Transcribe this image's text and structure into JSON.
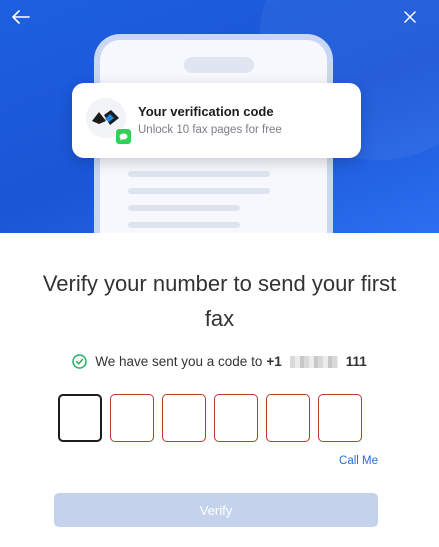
{
  "header": {
    "back_icon": "arrow-left-icon",
    "close_icon": "close-icon"
  },
  "notification": {
    "title": "Your verification code",
    "subtitle": "Unlock 10 fax pages for free",
    "app_icon": "fax-logo-icon",
    "badge_icon": "message-icon"
  },
  "main": {
    "heading_line1": "Verify your number to send your first",
    "heading_line2": "fax",
    "sent_text": "We have sent you a code to",
    "phone_prefix": "+1",
    "phone_suffix": "111",
    "call_me": "Call Me",
    "verify_label": "Verify"
  },
  "otp": {
    "digits": 6,
    "values": [
      "",
      "",
      "",
      "",
      "",
      ""
    ]
  },
  "colors": {
    "hero": "#1a56d6",
    "accent_link": "#1f6fd6",
    "otp_error_border": "#c0392b",
    "verify_disabled": "#c5d2ec",
    "success": "#27ae60"
  }
}
